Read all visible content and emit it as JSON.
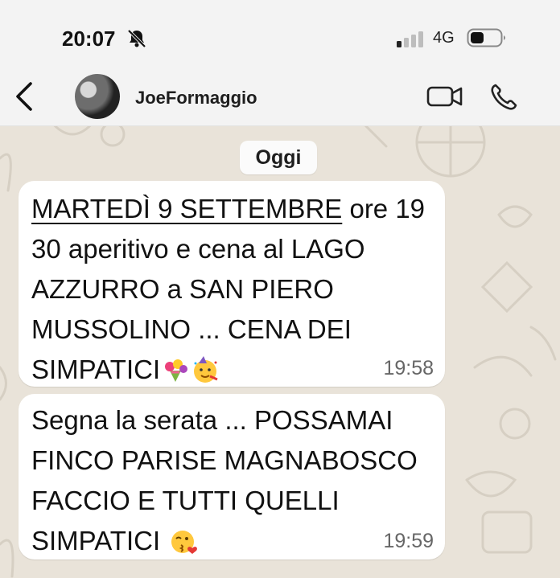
{
  "status_bar": {
    "time": "20:07",
    "network": "4G"
  },
  "header": {
    "contact_name": "JoeFormaggio"
  },
  "chat": {
    "date_pill": "Oggi",
    "messages": [
      {
        "date_link": "MARTEDÌ 9 SETTEMBRE",
        "text": " ore 19\n30 aperitivo e cena al LAGO\nAZZURRO a SAN PIERO\nMUSSOLINO ... CENA DEI\nSIMPATICI",
        "emojis": [
          "bouquet-emoji",
          "party-face-emoji"
        ],
        "time": "19:58"
      },
      {
        "text": "Segna la serata ... POSSAMAI\nFINCO PARISE MAGNABOSCO\nFACCIO E TUTTI QUELLI\nSIMPATICI ",
        "emojis": [
          "kissing-face-emoji"
        ],
        "time": "19:59"
      }
    ]
  },
  "colors": {
    "header_bg": "#f3f3f3",
    "chat_bg": "#e9e3d9",
    "bubble_bg": "#ffffff",
    "timestamp": "#666666"
  },
  "icons": [
    "bell-slash-icon",
    "signal-icon",
    "battery-icon",
    "back-icon",
    "video-call-icon",
    "phone-call-icon"
  ]
}
